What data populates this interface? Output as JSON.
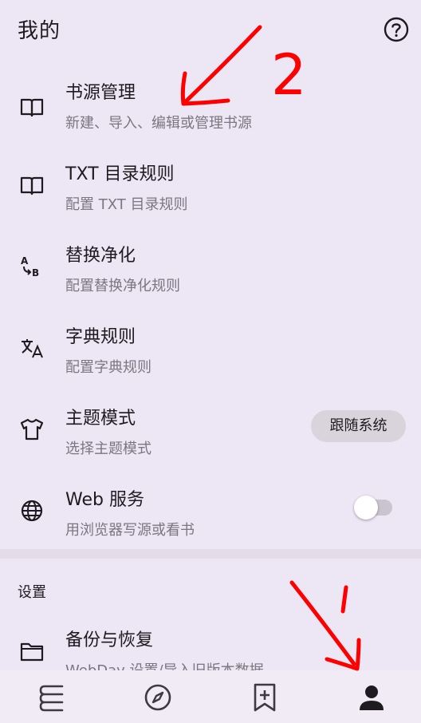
{
  "header": {
    "title": "我的",
    "help_icon": "help-circle-icon"
  },
  "items": [
    {
      "title": "书源管理",
      "subtitle": "新建、导入、编辑或管理书源",
      "icon": "book-open-icon"
    },
    {
      "title": "TXT 目录规则",
      "subtitle": "配置 TXT 目录规则",
      "icon": "book-open-icon"
    },
    {
      "title": "替换净化",
      "subtitle": "配置替换净化规则",
      "icon": "find-replace-icon"
    },
    {
      "title": "字典规则",
      "subtitle": "配置字典规则",
      "icon": "translate-icon"
    },
    {
      "title": "主题模式",
      "subtitle": "选择主题模式",
      "icon": "shirt-icon",
      "value": "跟随系统"
    },
    {
      "title": "Web 服务",
      "subtitle": "用浏览器写源或看书",
      "icon": "globe-icon",
      "enabled": false
    }
  ],
  "settings_section": {
    "label": "设置",
    "item": {
      "title": "备份与恢复",
      "subtitle": "WebDav 设置/导入旧版本数据",
      "icon": "folder-icon"
    }
  },
  "navbar": {
    "items": [
      {
        "icon": "bookshelf-icon"
      },
      {
        "icon": "compass-icon"
      },
      {
        "icon": "bookmark-add-icon"
      },
      {
        "icon": "person-icon",
        "active": true
      }
    ]
  },
  "annotations": {
    "number_label": "2"
  },
  "colors": {
    "background": "#ede6f4",
    "annotation": "#ff0000",
    "subtitle": "#7a7780"
  }
}
